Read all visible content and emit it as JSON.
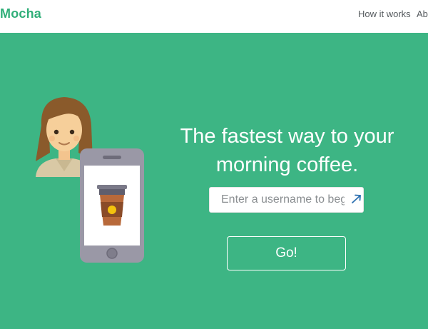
{
  "header": {
    "brand": "Mocha",
    "nav": [
      {
        "label": "How it works"
      },
      {
        "label": "Abo"
      }
    ]
  },
  "hero": {
    "headline_line1": "The fastest way to your",
    "headline_line2": "morning coffee.",
    "input_placeholder": "Enter a username to begin",
    "go_label": "Go!"
  },
  "colors": {
    "background": "#3db584",
    "brand": "#2fae78",
    "topbar": "#ffffff"
  },
  "icons": [
    "person-avatar-icon",
    "phone-icon",
    "coffee-cup-icon",
    "pointer-cursor-icon"
  ]
}
